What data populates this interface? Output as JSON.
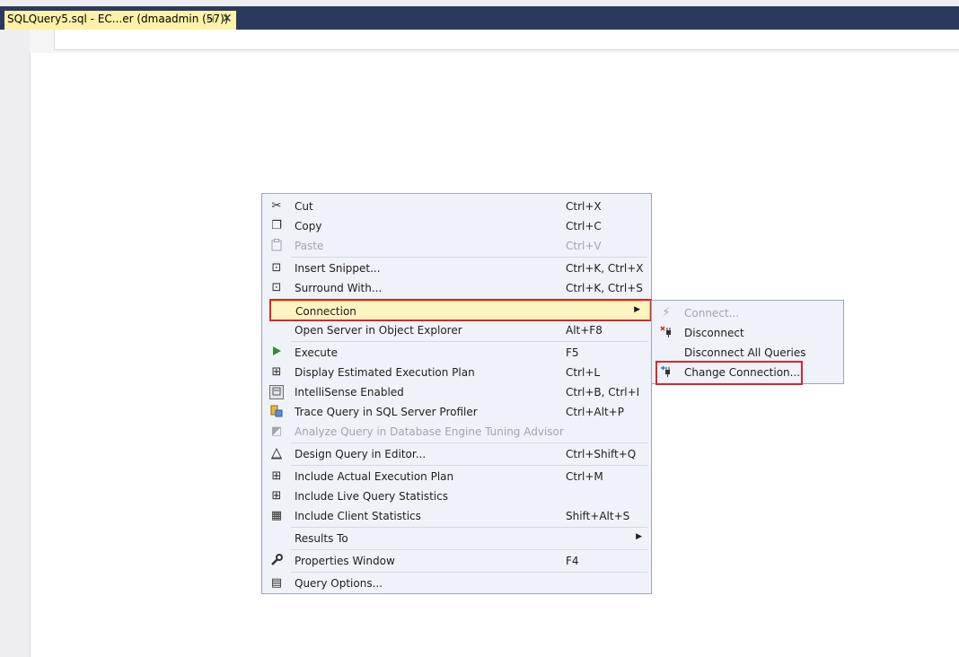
{
  "tab": {
    "title": "SQLQuery5.sql - EC...er (dmaadmin (57))",
    "pin_glyph": "⊣",
    "close_glyph": "✕"
  },
  "context_menu": {
    "items": [
      {
        "label": "Cut",
        "shortcut": "Ctrl+X",
        "icon": "scissors-icon",
        "disabled": false
      },
      {
        "label": "Copy",
        "shortcut": "Ctrl+C",
        "icon": "copy-icon",
        "disabled": false
      },
      {
        "label": "Paste",
        "shortcut": "Ctrl+V",
        "icon": "paste-icon",
        "disabled": true
      },
      {
        "label": "Insert Snippet...",
        "shortcut": "Ctrl+K, Ctrl+X",
        "icon": "insert-snippet-icon",
        "disabled": false
      },
      {
        "label": "Surround With...",
        "shortcut": "Ctrl+K, Ctrl+S",
        "icon": "surround-with-icon",
        "disabled": false
      },
      {
        "label": "Connection",
        "shortcut": "",
        "icon": "",
        "disabled": false,
        "submenu": true,
        "highlighted": true
      },
      {
        "label": "Open Server in Object Explorer",
        "shortcut": "Alt+F8",
        "icon": "",
        "disabled": false
      },
      {
        "label": "Execute",
        "shortcut": "F5",
        "icon": "play-icon",
        "disabled": false
      },
      {
        "label": "Display Estimated Execution Plan",
        "shortcut": "Ctrl+L",
        "icon": "execution-plan-icon",
        "disabled": false
      },
      {
        "label": "IntelliSense Enabled",
        "shortcut": "Ctrl+B, Ctrl+I",
        "icon": "intellisense-icon",
        "disabled": false
      },
      {
        "label": "Trace Query in SQL Server Profiler",
        "shortcut": "Ctrl+Alt+P",
        "icon": "profiler-icon",
        "disabled": false
      },
      {
        "label": "Analyze Query in Database Engine Tuning Advisor",
        "shortcut": "",
        "icon": "tuning-advisor-icon",
        "disabled": true
      },
      {
        "label": "Design Query in Editor...",
        "shortcut": "Ctrl+Shift+Q",
        "icon": "design-query-icon",
        "disabled": false
      },
      {
        "label": "Include Actual Execution Plan",
        "shortcut": "Ctrl+M",
        "icon": "actual-plan-icon",
        "disabled": false
      },
      {
        "label": "Include Live Query Statistics",
        "shortcut": "",
        "icon": "live-statistics-icon",
        "disabled": false
      },
      {
        "label": "Include Client Statistics",
        "shortcut": "Shift+Alt+S",
        "icon": "client-statistics-icon",
        "disabled": false
      },
      {
        "label": "Results To",
        "shortcut": "",
        "icon": "",
        "disabled": false,
        "submenu": true
      },
      {
        "label": "Properties Window",
        "shortcut": "F4",
        "icon": "wrench-icon",
        "disabled": false
      },
      {
        "label": "Query Options...",
        "shortcut": "",
        "icon": "query-options-icon",
        "disabled": false
      }
    ],
    "submenu_arrow": "▶"
  },
  "connection_submenu": {
    "items": [
      {
        "label": "Connect...",
        "icon": "connect-plug-icon",
        "disabled": true
      },
      {
        "label": "Disconnect",
        "icon": "disconnect-plug-icon",
        "disabled": false
      },
      {
        "label": "Disconnect All Queries",
        "icon": "",
        "disabled": false
      },
      {
        "label": "Change Connection...",
        "icon": "change-connection-icon",
        "disabled": false
      }
    ]
  },
  "colors": {
    "menu_bg": "#f0f2f9",
    "highlight": "#fdf4bf",
    "annotation_red": "#d9262c",
    "tab_active": "#fff1a8",
    "tabbar": "#2b3a5c"
  },
  "icon_glyphs": {
    "scissors": "✂",
    "copy": "❐",
    "paste": "📋",
    "snippet": "⊡",
    "play": "▶",
    "plan": "⊞",
    "intellisense": "▣",
    "profiler": "▤",
    "tuning": "◩",
    "design": "⛶",
    "stats": "▦",
    "wrench": "🔧",
    "options": "▤",
    "plug": "⚡",
    "disconnect": "✖",
    "change": "⇄"
  }
}
